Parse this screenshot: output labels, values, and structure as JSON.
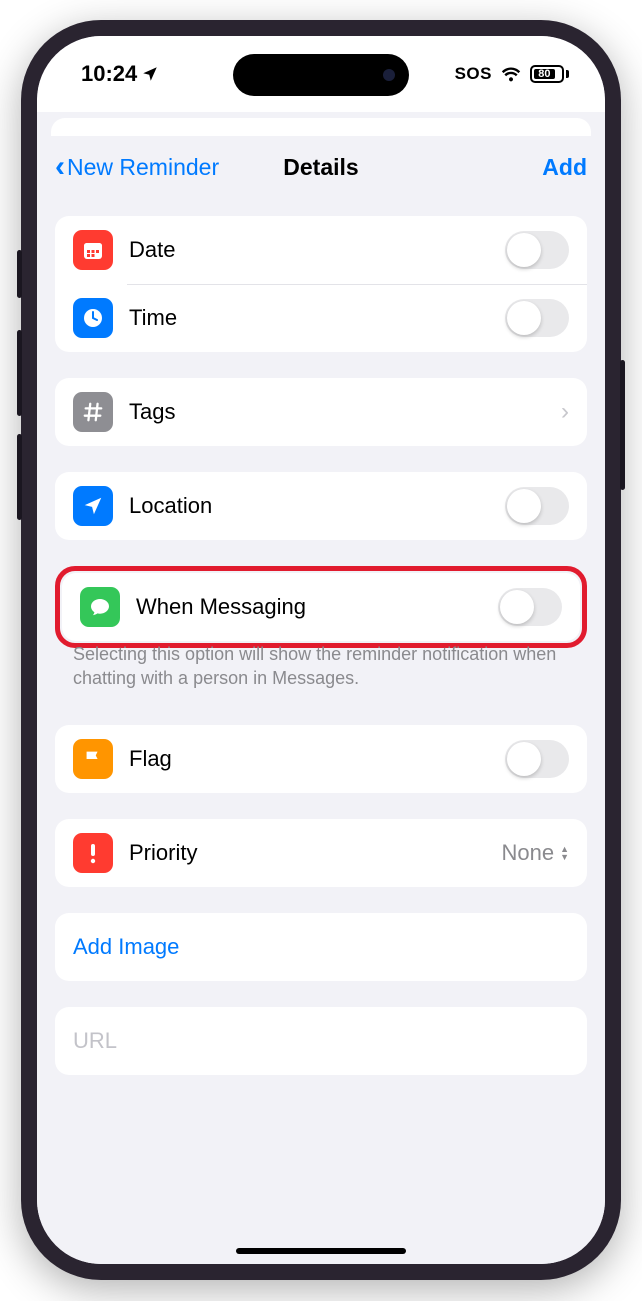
{
  "statusbar": {
    "time": "10:24",
    "sos": "SOS",
    "battery_pct": "80"
  },
  "nav": {
    "back": "New Reminder",
    "title": "Details",
    "action": "Add"
  },
  "rows": {
    "date": "Date",
    "time": "Time",
    "tags": "Tags",
    "location": "Location",
    "messaging": "When Messaging",
    "messaging_footer": "Selecting this option will show the reminder notification when chatting with a person in Messages.",
    "flag": "Flag",
    "priority": "Priority",
    "priority_value": "None",
    "add_image": "Add Image",
    "url_placeholder": "URL"
  },
  "colors": {
    "date": "#ff3b30",
    "time": "#007aff",
    "tags": "#8e8e93",
    "location": "#007aff",
    "messaging": "#34c759",
    "flag": "#ff9500",
    "priority": "#ff3b30",
    "accent": "#007aff"
  }
}
